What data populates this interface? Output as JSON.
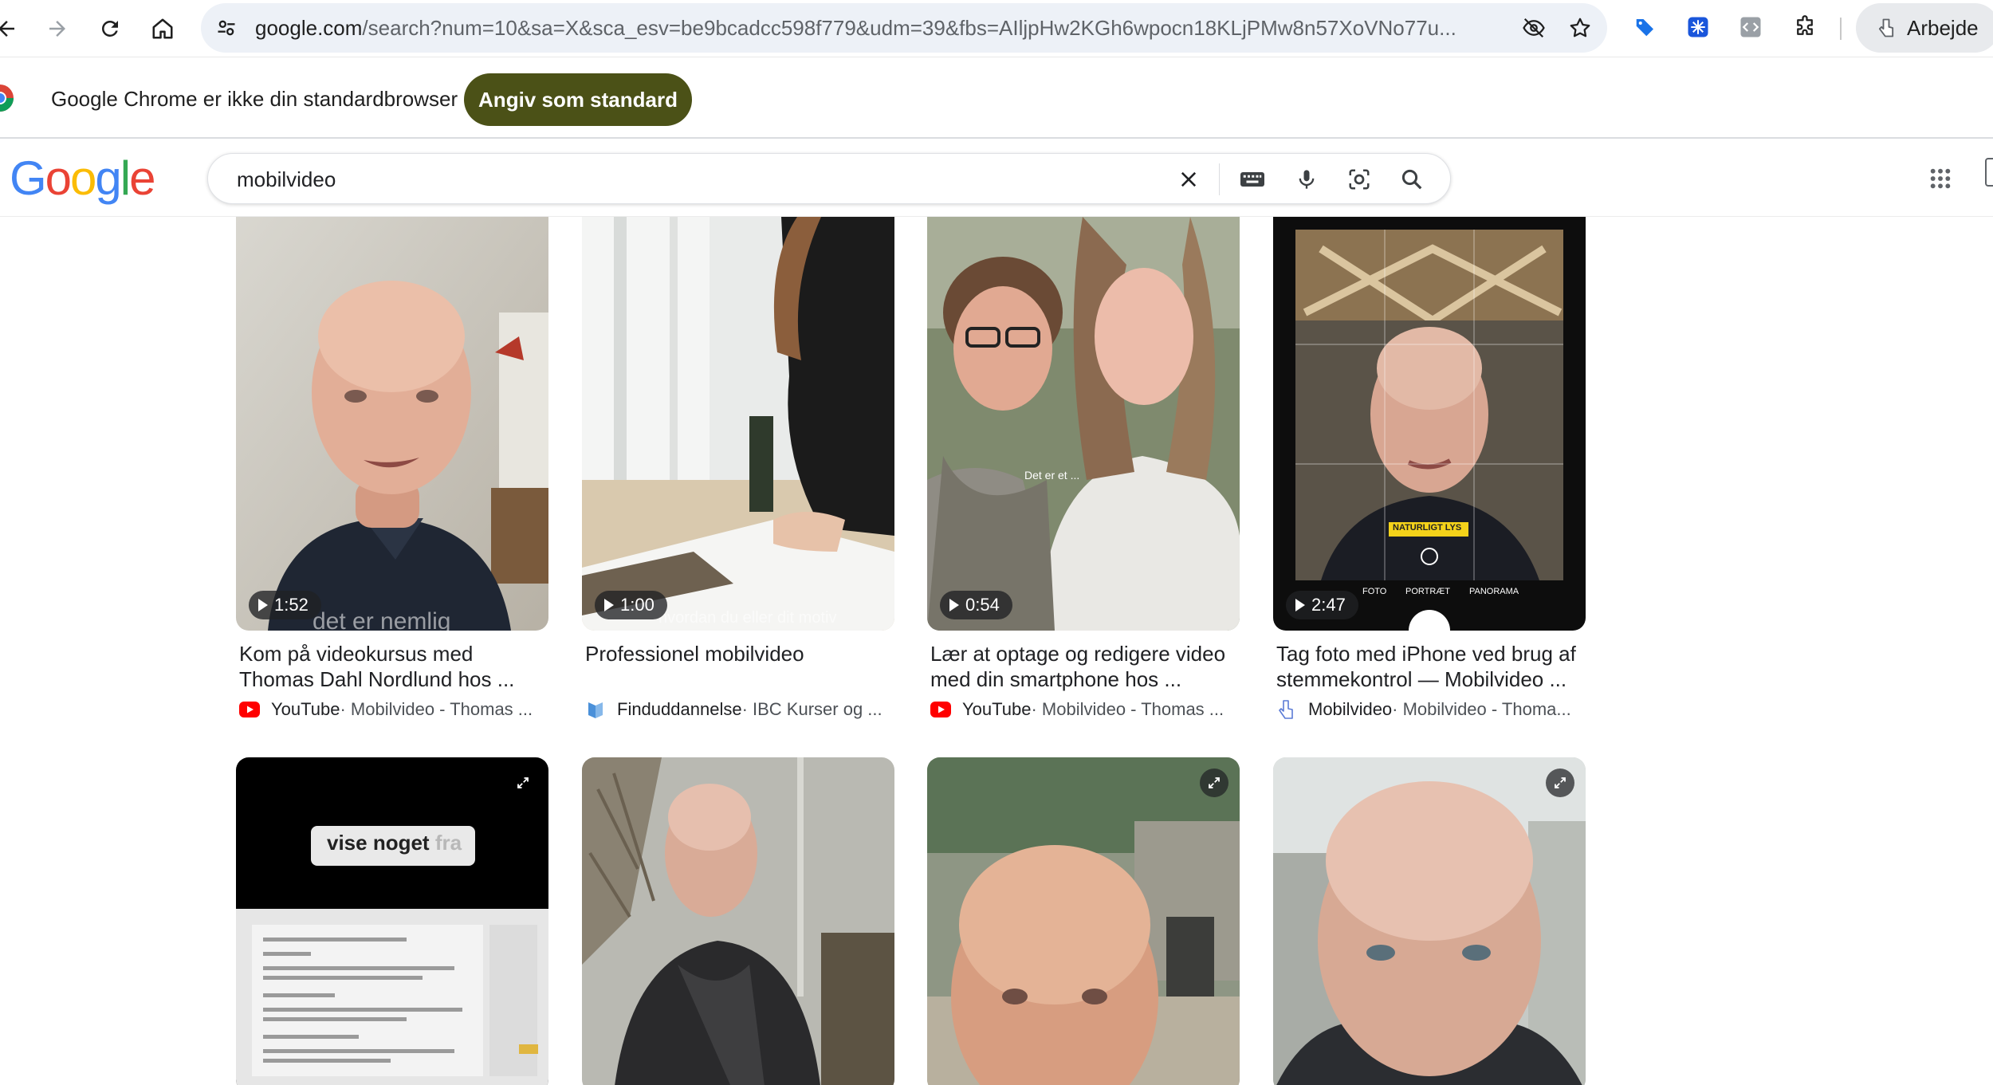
{
  "browser": {
    "url_host": "google.com",
    "url_rest": "/search?num=10&sa=X&sca_esv=be9bcadcc598f779&udm=39&fbs=AIljpHw2KGh6wpocn18KLjPMw8n57XoVNo77u...",
    "profile_name": "Arbejde"
  },
  "infobar": {
    "message": "Google Chrome er ikke din standardbrowser",
    "button_label": "Angiv som standard"
  },
  "search": {
    "logo_letters": [
      "G",
      "o",
      "o",
      "g",
      "l",
      "e"
    ],
    "query": "mobilvideo"
  },
  "results": [
    {
      "duration": "1:52",
      "title": "Kom på videokursus med Thomas Dahl Nordlund hos ...",
      "site": "YouTube",
      "rest": " · Mobilvideo - Thomas ...",
      "favicon": "youtube-icon",
      "caption": "det er nemlig"
    },
    {
      "duration": "1:00",
      "title": "Professionel mobilvideo",
      "site": "Finduddannelse",
      "rest": " · IBC Kurser og ...",
      "favicon": "book-icon",
      "caption": "hvordan du eller dit motiv"
    },
    {
      "duration": "0:54",
      "title": "Lær at optage og redigere video med din smartphone hos ...",
      "site": "YouTube",
      "rest": " · Mobilvideo - Thomas ...",
      "favicon": "youtube-icon",
      "caption": "Det er et ..."
    },
    {
      "duration": "2:47",
      "title": "Tag foto med iPhone ved brug af stemmekontrol — Mobilvideo ...",
      "site": "Mobilvideo",
      "rest": " · Mobilvideo - Thoma...",
      "favicon": "mobilvideo-icon",
      "camera_modes": [
        "FOTO",
        "PORTRÆT",
        "PANORAMA"
      ],
      "camera_badge": "NATURLIGT LYS"
    },
    {
      "overlay_text": "vise noget",
      "overlay_text_faded": "fra"
    },
    {},
    {},
    {}
  ],
  "colors": {
    "accent_button": "#4b5117",
    "google_blue": "#4285F4",
    "google_red": "#EA4335",
    "google_yellow": "#FBBC05",
    "google_green": "#34A853",
    "youtube_red": "#FF0000"
  }
}
